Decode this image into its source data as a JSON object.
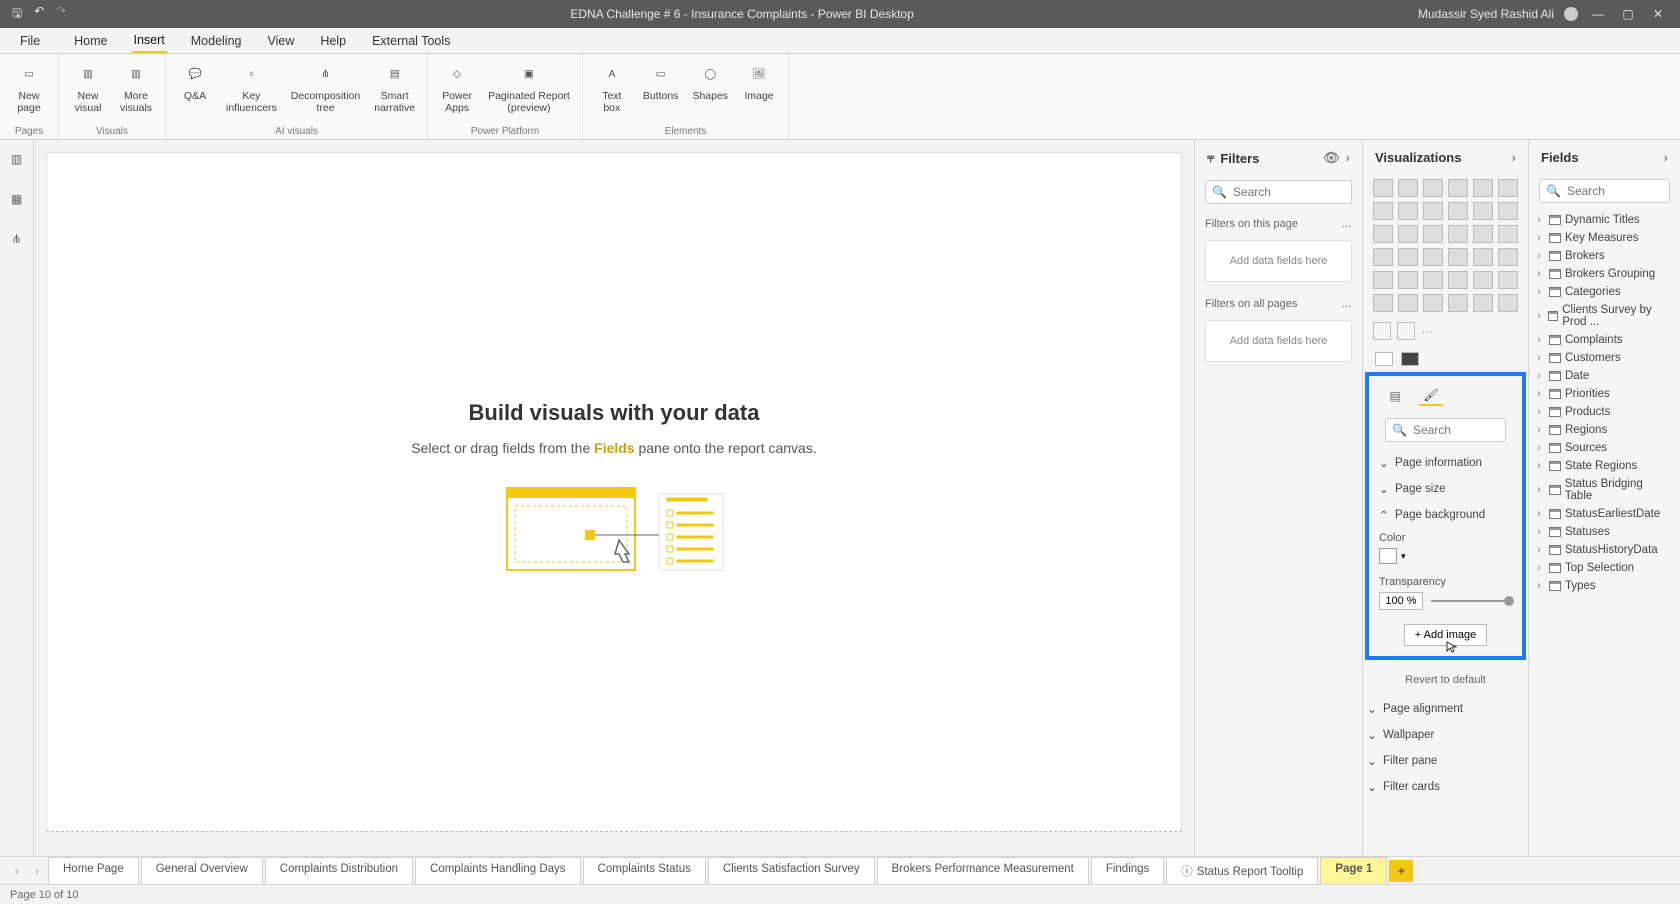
{
  "titlebar": {
    "title": "EDNA Challenge # 6 - Insurance Complaints - Power BI Desktop",
    "user": "Mudassir Syed Rashid Ali"
  },
  "tabs": {
    "file": "File",
    "items": [
      "Home",
      "Insert",
      "Modeling",
      "View",
      "Help",
      "External Tools"
    ],
    "active": "Insert"
  },
  "ribbon": {
    "pages": {
      "label": "Pages",
      "new_page": "New\npage"
    },
    "visuals": {
      "label": "Visuals",
      "new_visual": "New\nvisual",
      "more_visuals": "More\nvisuals"
    },
    "ai": {
      "label": "AI visuals",
      "qa": "Q&A",
      "ki": "Key\ninfluencers",
      "dt": "Decomposition\ntree",
      "sn": "Smart\nnarrative"
    },
    "pp": {
      "label": "Power Platform",
      "pa": "Power\nApps",
      "pr": "Paginated Report\n(preview)"
    },
    "el": {
      "label": "Elements",
      "tb": "Text\nbox",
      "bt": "Buttons",
      "sh": "Shapes",
      "im": "Image"
    }
  },
  "canvas": {
    "heading": "Build visuals with your data",
    "sub_pre": "Select or drag fields from the ",
    "sub_hl": "Fields",
    "sub_post": " pane onto the report canvas."
  },
  "filters": {
    "title": "Filters",
    "search": "Search",
    "on_page": "Filters on this page",
    "on_all": "Filters on all pages",
    "dz": "Add data fields here"
  },
  "viz": {
    "title": "Visualizations",
    "search": "Search",
    "sections": {
      "page_info": "Page information",
      "page_size": "Page size",
      "page_bg": "Page background",
      "color": "Color",
      "transparency": "Transparency",
      "transparency_val": "100 %",
      "add_image": "+ Add image",
      "revert": "Revert to default",
      "page_align": "Page alignment",
      "wallpaper": "Wallpaper",
      "filter_pane": "Filter pane",
      "filter_cards": "Filter cards"
    }
  },
  "fields": {
    "title": "Fields",
    "search": "Search",
    "tables": [
      "Dynamic Titles",
      "Key Measures",
      "Brokers",
      "Brokers Grouping",
      "Categories",
      "Clients Survey by Prod ...",
      "Complaints",
      "Customers",
      "Date",
      "Priorities",
      "Products",
      "Regions",
      "Sources",
      "State Regions",
      "Status Bridging Table",
      "StatusEarliestDate",
      "Statuses",
      "StatusHistoryData",
      "Top Selection",
      "Types"
    ]
  },
  "pagetabs": {
    "items": [
      "Home Page",
      "General Overview",
      "Complaints Distribution",
      "Complaints Handling Days",
      "Complaints Status",
      "Clients Satisfaction Survey",
      "Brokers Performance Measurement",
      "Findings",
      "Status Report Tooltip",
      "Page 1"
    ],
    "active": "Page 1"
  },
  "status": {
    "page": "Page 10 of 10"
  }
}
